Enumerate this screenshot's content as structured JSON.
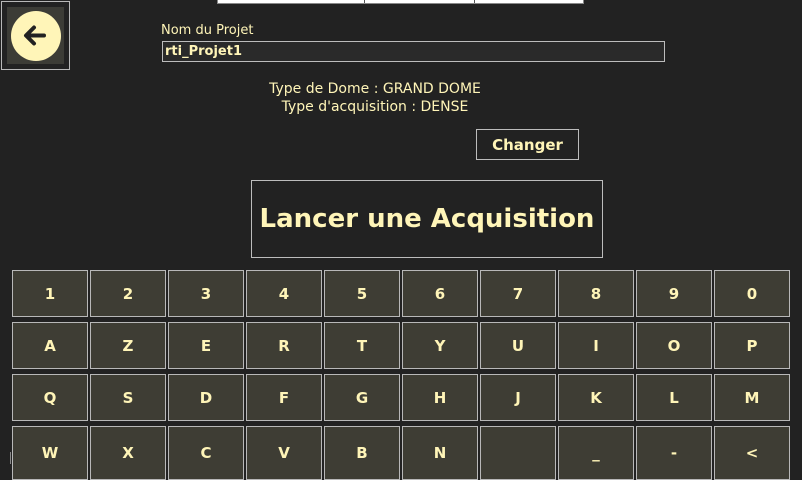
{
  "project": {
    "label": "Nom du Projet",
    "value": "rti_Projet1"
  },
  "info": {
    "dome_type": "Type de Dome : GRAND DOME",
    "acquisition_type": "Type d'acquisition : DENSE"
  },
  "buttons": {
    "change": "Changer",
    "launch": "Lancer une Acquisition"
  },
  "keyboard": {
    "rows": [
      [
        "1",
        "2",
        "3",
        "4",
        "5",
        "6",
        "7",
        "8",
        "9",
        "0"
      ],
      [
        "A",
        "Z",
        "E",
        "R",
        "T",
        "Y",
        "U",
        "I",
        "O",
        "P"
      ],
      [
        "Q",
        "S",
        "D",
        "F",
        "G",
        "H",
        "J",
        "K",
        "L",
        "M"
      ],
      [
        "W",
        "X",
        "C",
        "V",
        "B",
        "N",
        "",
        "_",
        "-",
        "<"
      ]
    ]
  },
  "icons": {
    "back": "arrow-left-icon"
  },
  "colors": {
    "background": "#222222",
    "text": "#fff5b8",
    "key_bg": "#3e3d34",
    "border": "#b8b8b8"
  }
}
